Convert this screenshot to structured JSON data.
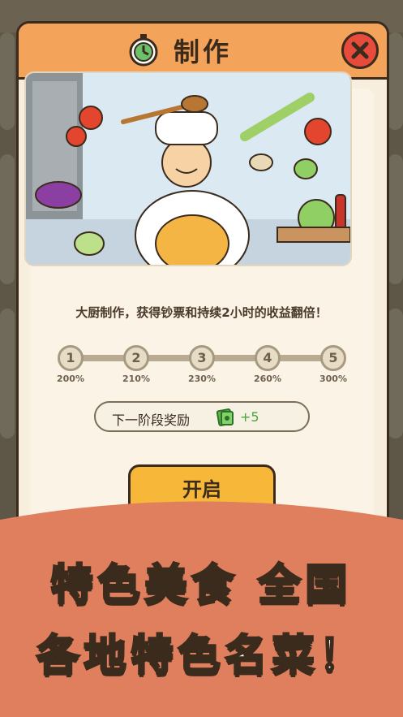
{
  "dialog": {
    "title": "制作",
    "description": "大厨制作，获得钞票和持续2小时的收益翻倍！",
    "steps": [
      {
        "number": "1",
        "percent": "200%"
      },
      {
        "number": "2",
        "percent": "210%"
      },
      {
        "number": "3",
        "percent": "230%"
      },
      {
        "number": "4",
        "percent": "260%"
      },
      {
        "number": "5",
        "percent": "300%"
      }
    ],
    "reward": {
      "label": "下一阶段奖励",
      "value": "+5",
      "icon": "cash-icon"
    },
    "start_label": "开启",
    "close_icon": "close-icon",
    "title_icon": "clock-icon"
  },
  "banner": {
    "line1": "特色美食 全国",
    "line2": "各地特色名菜！"
  },
  "colors": {
    "header": "#f4a35b",
    "close": "#e64b3c",
    "start": "#f7b739",
    "banner": "#e07f5e"
  }
}
